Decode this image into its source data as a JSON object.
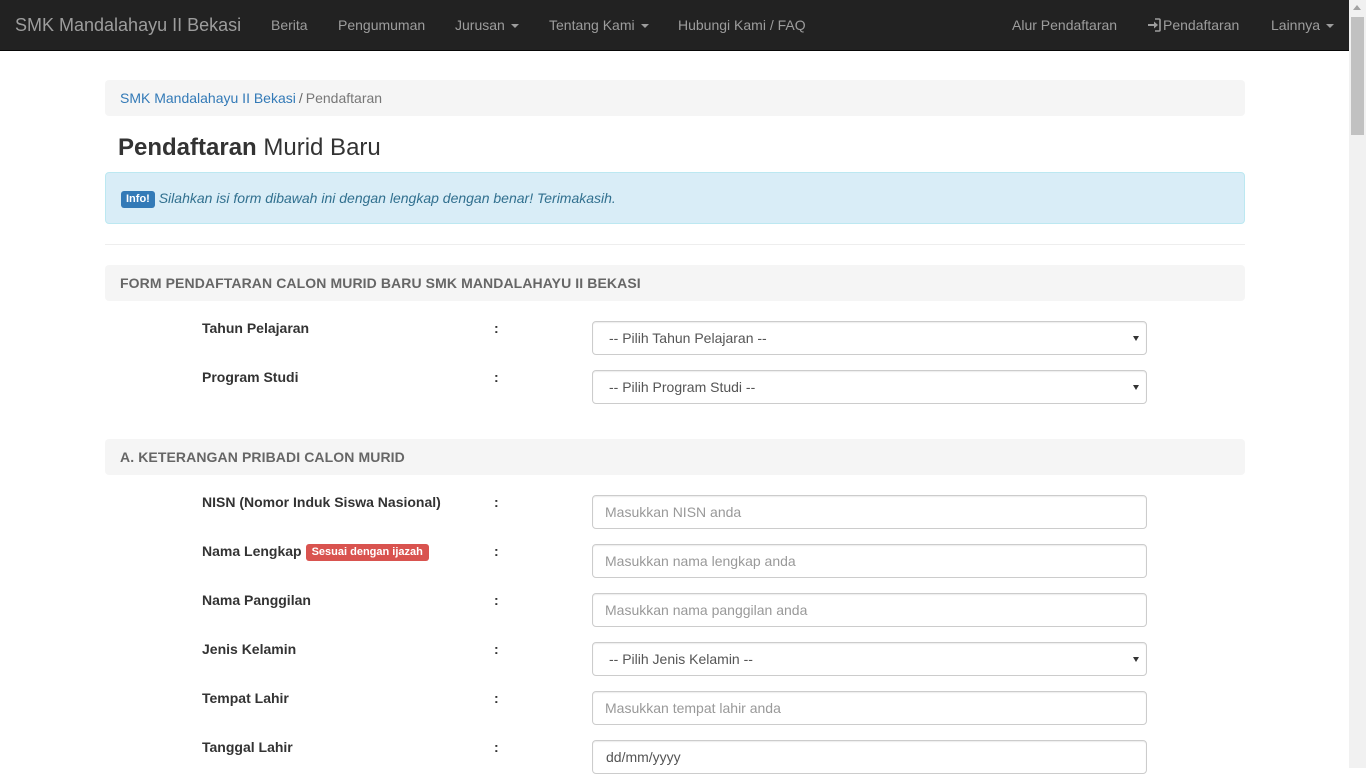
{
  "navbar": {
    "brand": "SMK Mandalahayu II Bekasi",
    "items": [
      "Berita",
      "Pengumuman",
      "Jurusan",
      "Tentang Kami",
      "Hubungi Kami / FAQ"
    ],
    "right_items": [
      "Alur Pendaftaran",
      "Pendaftaran",
      "Lainnya"
    ]
  },
  "breadcrumb": {
    "home": "SMK Mandalahayu II Bekasi",
    "separator": "/",
    "current": "Pendaftaran"
  },
  "page": {
    "title_bold": "Pendaftaran",
    "title_rest": "Murid Baru"
  },
  "alert": {
    "badge": "Info!",
    "text": "Silahkan isi form dibawah ini dengan lengkap dengan benar! Terimakasih."
  },
  "sections": {
    "form_header": "FORM PENDAFTARAN CALON MURID BARU SMK MANDALAHAYU II BEKASI",
    "personal_header": "A. KETERANGAN PRIBADI CALON MURID"
  },
  "colon": ":",
  "fields": {
    "tahun": {
      "label": "Tahun Pelajaran",
      "value": "-- Pilih Tahun Pelajaran --"
    },
    "program": {
      "label": "Program Studi",
      "value": "-- Pilih Program Studi --"
    },
    "nisn": {
      "label": "NISN (Nomor Induk Siswa Nasional)",
      "placeholder": "Masukkan NISN anda"
    },
    "nama": {
      "label": "Nama Lengkap",
      "badge": "Sesuai dengan ijazah",
      "placeholder": "Masukkan nama lengkap anda"
    },
    "panggilan": {
      "label": "Nama Panggilan",
      "placeholder": "Masukkan nama panggilan anda"
    },
    "kelamin": {
      "label": "Jenis Kelamin",
      "value": "-- Pilih Jenis Kelamin --"
    },
    "tempat": {
      "label": "Tempat Lahir",
      "placeholder": "Masukkan tempat lahir anda"
    },
    "tanggal": {
      "label": "Tanggal Lahir",
      "value": "dd/mm/yyyy"
    }
  },
  "colors": {
    "navbar_bg": "#222222",
    "link": "#337ab7",
    "alert_bg": "#d9edf7",
    "danger": "#d9534f"
  }
}
